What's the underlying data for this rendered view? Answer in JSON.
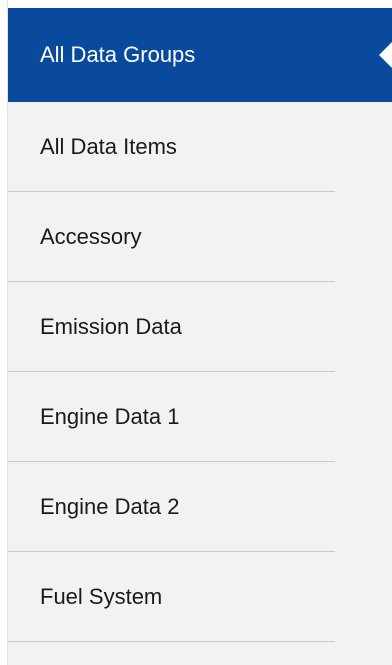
{
  "menu": {
    "items": [
      {
        "label": "All Data Groups",
        "selected": true
      },
      {
        "label": "All Data Items",
        "selected": false
      },
      {
        "label": "Accessory",
        "selected": false
      },
      {
        "label": "Emission Data",
        "selected": false
      },
      {
        "label": "Engine Data 1",
        "selected": false
      },
      {
        "label": "Engine Data 2",
        "selected": false
      },
      {
        "label": "Fuel System",
        "selected": false
      }
    ]
  },
  "colors": {
    "selected_background": "#0a4a9c",
    "selected_text": "#ffffff",
    "item_text": "#1a1a1a",
    "panel_background": "#f2f2f2",
    "divider": "#c9c9c9"
  }
}
